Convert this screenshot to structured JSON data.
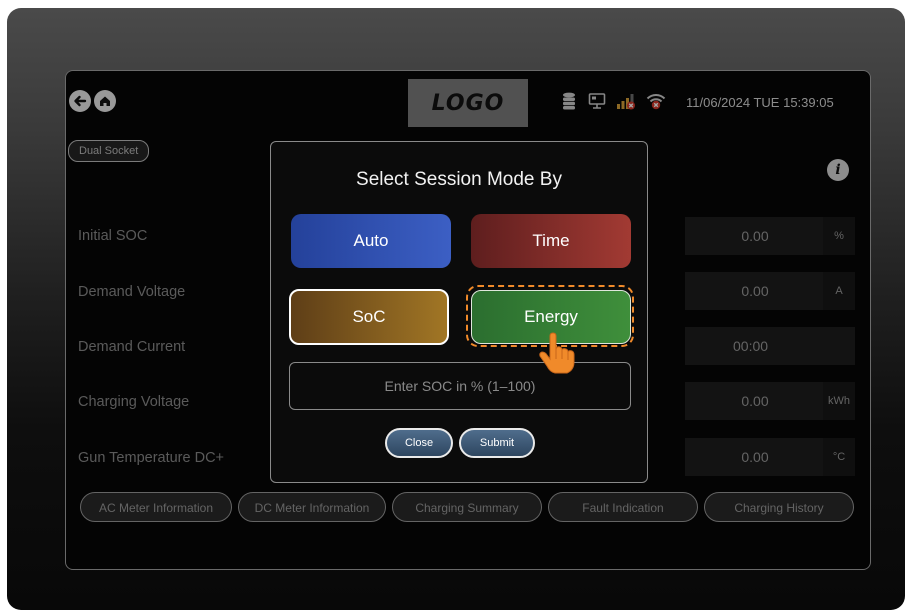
{
  "header": {
    "logo": "LOGO",
    "datetime": "11/06/2024 TUE 15:39:05",
    "nav": {
      "back_icon": "arrow-left-icon",
      "home_icon": "home-icon"
    },
    "status_icons": [
      "database-icon",
      "monitor-network-icon",
      "signal-bars-disconnected-icon",
      "wifi-disconnected-icon"
    ]
  },
  "socket_chip": "Dual Socket",
  "rows": [
    {
      "label": "Initial SOC",
      "value": "0.00",
      "unit": "%"
    },
    {
      "label": "Demand Voltage",
      "value": "0.00",
      "unit": "A"
    },
    {
      "label": "Demand Current",
      "value": "00:00",
      "unit": ""
    },
    {
      "label": "Charging Voltage",
      "value": "0.00",
      "unit": "kWh"
    },
    {
      "label": "Gun Temperature DC+",
      "value": "0.00",
      "unit": "°C"
    }
  ],
  "bottom_tabs": [
    "AC Meter Information",
    "DC Meter Information",
    "Charging Summary",
    "Fault Indication",
    "Charging History"
  ],
  "modal": {
    "title": "Select Session Mode By",
    "modes": {
      "auto": "Auto",
      "time": "Time",
      "soc": "SoC",
      "energy": "Energy"
    },
    "input_placeholder": "Enter SOC in % (1–100)",
    "close_label": "Close",
    "submit_label": "Submit"
  },
  "colors": {
    "auto": "#3354b8",
    "time": "#8e302d",
    "soc": "#8a6322",
    "energy": "#368236",
    "highlight": "#f08a2a"
  }
}
